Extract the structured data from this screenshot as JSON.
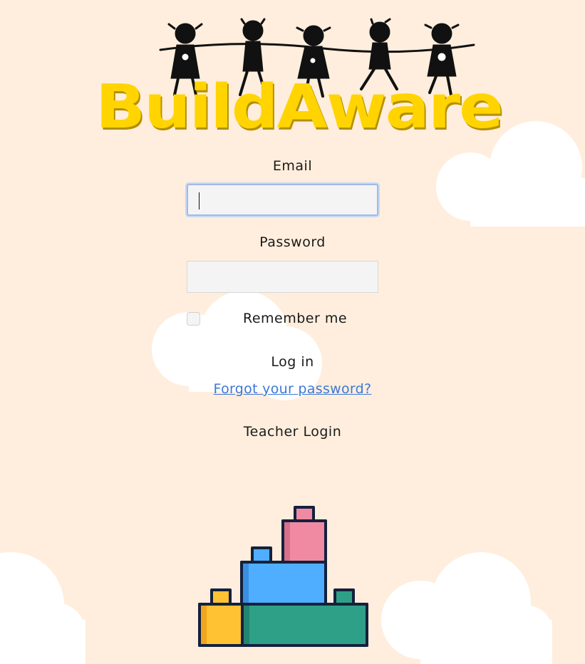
{
  "app": {
    "logo_text": "BuildAware"
  },
  "form": {
    "email_label": "Email",
    "email_value": "",
    "password_label": "Password",
    "password_value": "",
    "remember_label": "Remember me",
    "remember_checked": false,
    "login_label": "Log in",
    "forgot_label": "Forgot your password?",
    "teacher_label": "Teacher Login"
  },
  "colors": {
    "background": "#FFEEDD",
    "cloud": "#FFFFFF",
    "logo_yellow": "#FFD400",
    "link_blue": "#3B78D8",
    "block_yellow": "#FFC233",
    "block_blue": "#4FAEFF",
    "block_pink": "#F08AA3",
    "block_green": "#2EA087"
  },
  "icons": {
    "logo_figures": "children-holding-hands-icon",
    "footer_image": "stacked-toy-blocks-icon"
  }
}
